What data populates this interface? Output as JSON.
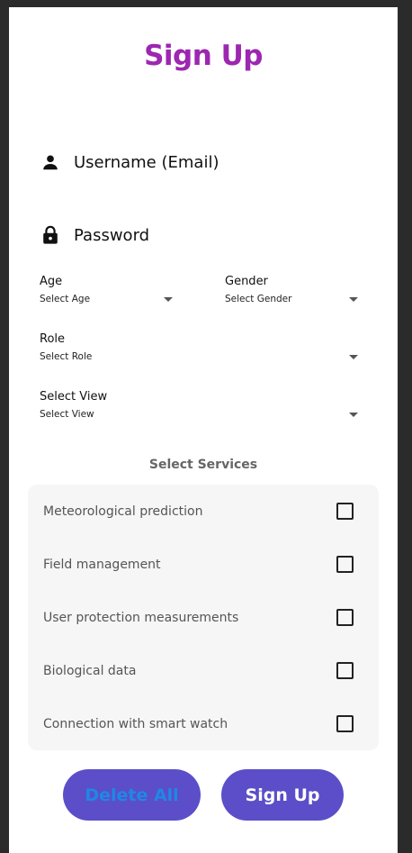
{
  "title": "Sign Up",
  "fields": {
    "username_label": "Username (Email)",
    "password_label": "Password"
  },
  "dropdowns": {
    "age": {
      "label": "Age",
      "value": "Select Age"
    },
    "gender": {
      "label": "Gender",
      "value": "Select Gender"
    },
    "role": {
      "label": "Role",
      "value": "Select Role"
    },
    "view": {
      "label": "Select View",
      "value": "Select View"
    }
  },
  "services": {
    "title": "Select Services",
    "items": [
      {
        "label": "Meteorological prediction",
        "checked": false
      },
      {
        "label": "Field management",
        "checked": false
      },
      {
        "label": "User protection measurements",
        "checked": false
      },
      {
        "label": "Biological data",
        "checked": false
      },
      {
        "label": "Connection with smart watch",
        "checked": false
      }
    ]
  },
  "buttons": {
    "delete_all": "Delete All",
    "sign_up": "Sign Up"
  },
  "colors": {
    "title": "#9c27b0",
    "button_bg": "#5b4ec8",
    "delete_text": "#1e88e5",
    "signup_text": "#ffffff",
    "service_bg": "#f6f6f6"
  },
  "icons": {
    "username": "person-icon",
    "password": "lock-icon",
    "dropdown": "arrow-drop-down-icon"
  }
}
